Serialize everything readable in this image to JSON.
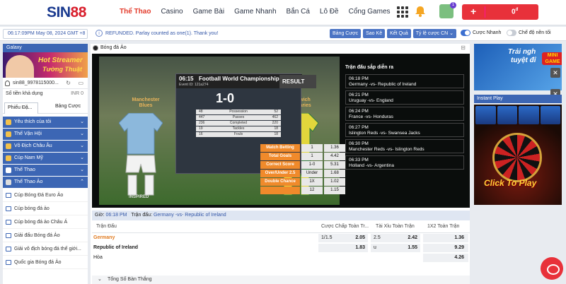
{
  "header": {
    "logo_main": "SIN",
    "logo_num": "88",
    "nav": [
      "Thể Thao",
      "Casino",
      "Game Bài",
      "Game Nhanh",
      "Bắn Cá",
      "Lô Đề",
      "Cổng Games"
    ],
    "notif_count": "1",
    "deposit_amount": "0",
    "deposit_currency": "đ",
    "deposit_plus": "+"
  },
  "subbar": {
    "datetime": "06:17:09PM May 08, 2024 GMT +8",
    "message": "REFUNDED. Parlay counted as one(1). Thank you!",
    "buttons": [
      "Bảng Cược",
      "Sao Kê",
      "Kết Quả",
      "Tỷ lệ cược CN ⌄"
    ],
    "toggle1_label": "Cược Nhanh",
    "toggle2_label": "Chế độ nền tối"
  },
  "sidebar": {
    "galaxy": "Galaxy",
    "banner_line1": "Hot Streamer",
    "banner_line2": "Tường Thuật",
    "username": "sin88_9978115000...",
    "balance_label": "Số tiền khả dụng",
    "balance_value": "INR 0",
    "tab_active": "Phiếu Đặ...",
    "tab_other": "Bảng Cược",
    "menu": [
      "Yêu thích của tôi",
      "Thế Vận Hội",
      "Vô Địch Châu Âu",
      "Cúp Nam Mỹ",
      "Thể Thao",
      "Thể Thao Ảo"
    ],
    "submenu": [
      "Cúp Bóng Đá Euro Ảo",
      "Cúp bóng đá ảo",
      "Cúp bóng đá ảo Châu Á",
      "Giải đấu Bóng đá Ảo",
      "Giải vô địch bóng đá thế giới...",
      "Quốc gia Bóng đá Ảo"
    ]
  },
  "main": {
    "header": "Bóng đá Ảo",
    "video": {
      "time": "06:15",
      "title": "Football World Championship",
      "event_id": "Event ID: 121a274",
      "result": "RESULT",
      "home": "Manchester Blues",
      "away": "Norwich Canaries",
      "score": "1-0",
      "stats": [
        [
          "48",
          "Possession",
          "52"
        ],
        [
          "447",
          "Passes",
          "462"
        ],
        [
          "236",
          "Completed",
          "220"
        ],
        [
          "19",
          "Tackles",
          "18"
        ],
        [
          "16",
          "Fouls",
          "18"
        ]
      ],
      "odds": [
        {
          "label": "Match Betting",
          "sel": "1",
          "val": "1.36"
        },
        {
          "label": "Total Goals",
          "sel": "1",
          "val": "4.42"
        },
        {
          "label": "Correct Score",
          "sel": "1-0",
          "val": "5.31"
        },
        {
          "label": "Over/Under 2.5",
          "sel": "Under",
          "val": "1.68"
        },
        {
          "label": "Double Chance",
          "sel": "1X",
          "val": "1.02"
        },
        {
          "label": "",
          "sel": "12",
          "val": "1.15"
        }
      ],
      "brand": "INSPIRED",
      "upcoming_title": "Trận đấu sắp diễn ra",
      "upcoming": [
        {
          "time": "06:18 PM",
          "match": "Germany -vs- Republic of Ireland"
        },
        {
          "time": "06:21 PM",
          "match": "Uruguay -vs- England"
        },
        {
          "time": "06:24 PM",
          "match": "France -vs- Honduras"
        },
        {
          "time": "06:27 PM",
          "match": "Islington Reds -vs- Swansea Jacks"
        },
        {
          "time": "06:30 PM",
          "match": "Manchester Reds -vs- Islington Reds"
        },
        {
          "time": "06:33 PM",
          "match": "Holland -vs- Argentina"
        }
      ]
    },
    "matchbar": {
      "time_label": "Giờ:",
      "time": "06:18 PM",
      "match_label": "Trận đấu:",
      "match": "Germany -vs- Republic of Ireland"
    },
    "table": {
      "col_match": "Trận Đấu",
      "col_hcp": "Cược Chấp Toàn Tr...",
      "col_ou": "Tài Xỉu Toàn Trận",
      "col_1x2": "1X2 Toàn Trận",
      "rows": [
        {
          "team": "Germany",
          "hcp_line": "1/1.5",
          "hcp_odd": "2.05",
          "ou_line": "2.5",
          "ou_odd": "2.42",
          "x12": "1.36"
        },
        {
          "team": "Republic of Ireland",
          "hcp_line": "",
          "hcp_odd": "1.83",
          "ou_line": "u",
          "ou_odd": "1.55",
          "x12": "9.29"
        },
        {
          "team": "Hòa",
          "hcp_line": "",
          "hcp_odd": "",
          "ou_line": "",
          "ou_odd": "",
          "x12": "4.26"
        }
      ],
      "totals": "Tổng Số Bàn Thắng"
    }
  },
  "right": {
    "banner_line1": "Trải ngh",
    "banner_line2": "tuyệt đỉ",
    "mini_line1": "MINI",
    "mini_line2": "GAME",
    "instant_play": "Instant Play",
    "click_to_play": "Click To Play"
  },
  "colors": {
    "accent": "#e33a2a",
    "brand_blue": "#3c66b4",
    "deposit_red": "#e8313a"
  }
}
